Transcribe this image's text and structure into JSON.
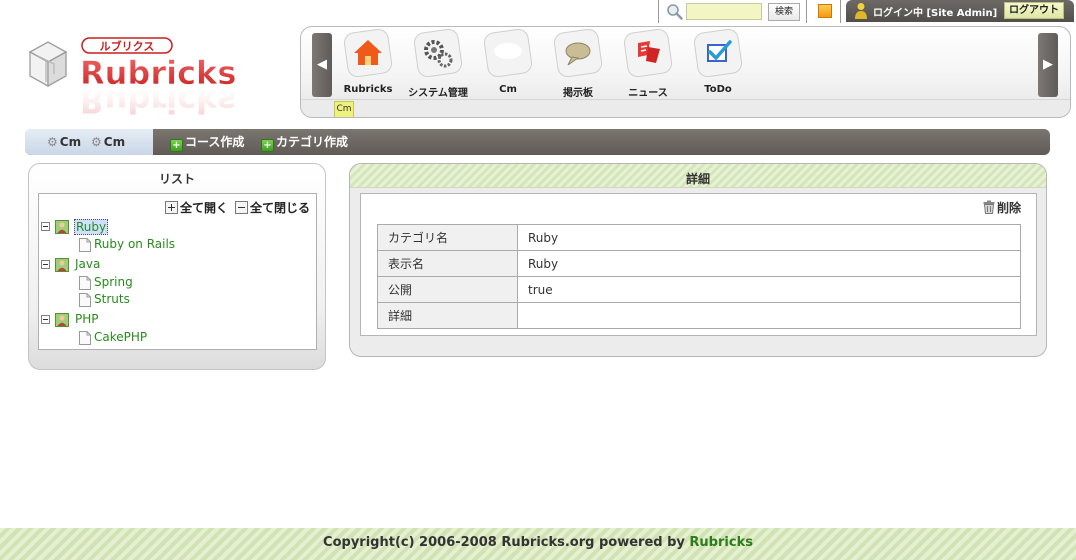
{
  "topbar": {
    "search_placeholder": "",
    "search_button": "検索",
    "login_text": "ログイン中 [Site Admin]",
    "logout": "ログアウト",
    "accent": "#f49a10"
  },
  "logo": {
    "kana": "ルブリクス",
    "name": "Rubricks"
  },
  "nav": {
    "items": [
      {
        "label": "Rubricks",
        "icon": "home-icon"
      },
      {
        "label": "システム管理",
        "icon": "gears-icon"
      },
      {
        "label": "Cm",
        "icon": "blank-icon"
      },
      {
        "label": "掲示板",
        "icon": "speech-bubble-icon"
      },
      {
        "label": "ニュース",
        "icon": "news-icon"
      },
      {
        "label": "ToDo",
        "icon": "checkbox-icon"
      }
    ],
    "sub_tab": "Cm"
  },
  "breadcrumb": {
    "items": [
      "Cm",
      "Cm"
    ]
  },
  "actions": {
    "create_course": "コース作成",
    "create_category": "カテゴリ作成"
  },
  "list": {
    "title": "リスト",
    "expand_all": "全て開く",
    "collapse_all": "全て閉じる",
    "tree": [
      {
        "label": "Ruby",
        "selected": true,
        "children": [
          "Ruby on Rails"
        ]
      },
      {
        "label": "Java",
        "children": [
          "Spring",
          "Struts"
        ]
      },
      {
        "label": "PHP",
        "children": [
          "CakePHP"
        ]
      }
    ]
  },
  "detail": {
    "title": "詳細",
    "delete": "削除",
    "rows": [
      {
        "key": "カテゴリ名",
        "value": "Ruby"
      },
      {
        "key": "表示名",
        "value": "Ruby"
      },
      {
        "key": "公開",
        "value": "true"
      },
      {
        "key": "詳細",
        "value": ""
      }
    ]
  },
  "footer": {
    "text": "Copyright(c) 2006-2008 Rubricks.org powered by",
    "link": "Rubricks"
  }
}
